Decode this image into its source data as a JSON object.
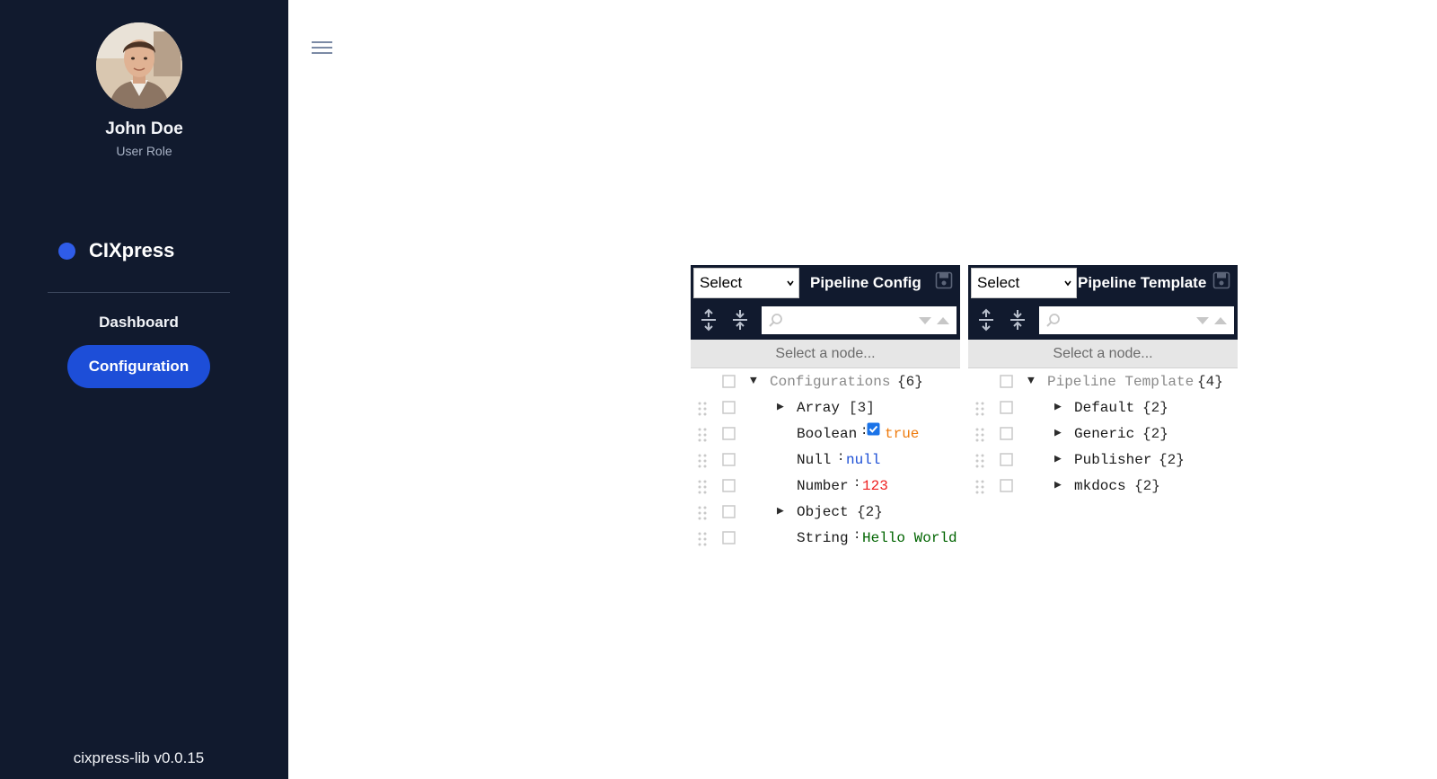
{
  "sidebar": {
    "user": {
      "name": "John Doe",
      "role": "User Role"
    },
    "brand": {
      "name": "CIXpress",
      "dot_color": "#2f5ce8"
    },
    "nav": {
      "dashboard": "Dashboard",
      "configuration": "Configuration"
    },
    "version": "cixpress-lib v0.0.15"
  },
  "editors": [
    {
      "select_value": "Select",
      "title": "Pipeline Config",
      "navbar": "Select a node...",
      "search_value": "",
      "root": {
        "field": "Configurations",
        "count": "{6}"
      },
      "rows": [
        {
          "field": "Array",
          "count": "[3]",
          "type": "array"
        },
        {
          "field": "Boolean",
          "value": "true",
          "type": "boolean"
        },
        {
          "field": "Null",
          "value": "null",
          "type": "null"
        },
        {
          "field": "Number",
          "value": "123",
          "type": "number"
        },
        {
          "field": "Object",
          "count": "{2}",
          "type": "object"
        },
        {
          "field": "String",
          "value": "Hello World",
          "type": "string"
        }
      ]
    },
    {
      "select_value": "Select",
      "title": "Pipeline Template",
      "navbar": "Select a node...",
      "search_value": "",
      "root": {
        "field": "Pipeline Template",
        "count": "{4}"
      },
      "rows": [
        {
          "field": "Default",
          "count": "{2}",
          "type": "object"
        },
        {
          "field": "Generic",
          "count": "{2}",
          "type": "object"
        },
        {
          "field": "Publisher",
          "count": "{2}",
          "type": "object"
        },
        {
          "field": "mkdocs",
          "count": "{2}",
          "type": "object"
        }
      ]
    }
  ],
  "colors": {
    "sidebar_bg": "#111a2e",
    "accent": "#1d4ed8",
    "boolean": "#ee7a0c",
    "null": "#1c4fd6",
    "number": "#ee2222",
    "string": "#006400"
  }
}
